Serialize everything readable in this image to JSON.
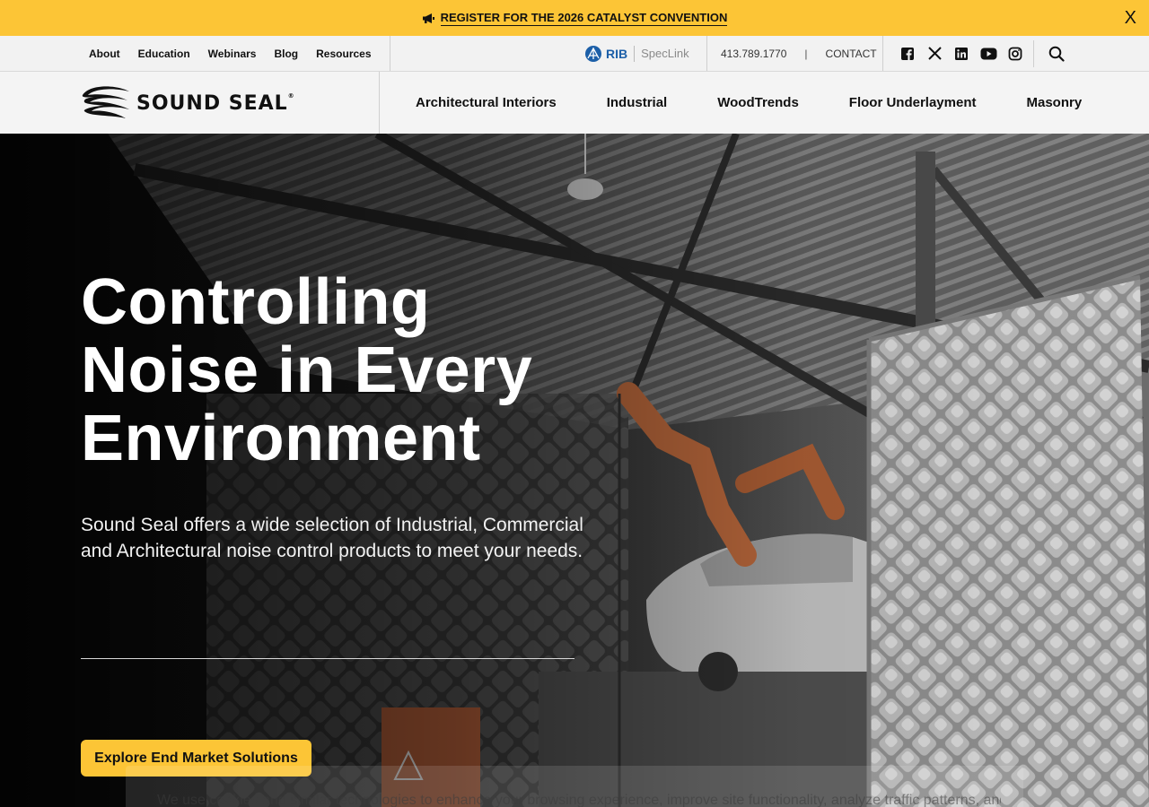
{
  "announcement": {
    "label": "REGISTER FOR THE 2026 CATALYST CONVENTION",
    "close_label": "X"
  },
  "utility_nav": {
    "items": [
      {
        "label": "About"
      },
      {
        "label": "Education"
      },
      {
        "label": "Webinars"
      },
      {
        "label": "Blog"
      },
      {
        "label": "Resources"
      }
    ],
    "speclink": {
      "rib": "RIB",
      "name": "SpecLink"
    },
    "phone": "413.789.1770",
    "separator": "|",
    "contact_label": "CONTACT",
    "social_icons": [
      "facebook-icon",
      "x-twitter-icon",
      "linkedin-icon",
      "youtube-icon",
      "instagram-icon"
    ],
    "search_icon": "search-icon"
  },
  "brand": {
    "name": "Sound Seal",
    "registered": "®"
  },
  "main_nav": {
    "items": [
      {
        "label": "Architectural Interiors"
      },
      {
        "label": "Industrial"
      },
      {
        "label": "WoodTrends"
      },
      {
        "label": "Floor Underlayment"
      },
      {
        "label": "Masonry"
      }
    ]
  },
  "hero": {
    "title_line1": "Controlling",
    "title_line2": "Noise in Every",
    "title_line3": "Environment",
    "subtitle": "Sound Seal offers a wide selection of Industrial, Commercial and Architectural noise control products to meet your needs.",
    "cta_label": "Explore End Market Solutions"
  },
  "cookie_banner": {
    "text": "We use cookies and similar technologies to enhance your browsing experience, improve site functionality, analyze traffic patterns, and"
  },
  "colors": {
    "accent_yellow": "#fcc536",
    "speclink_blue": "#1c5fa8",
    "text_dark": "#111111"
  }
}
